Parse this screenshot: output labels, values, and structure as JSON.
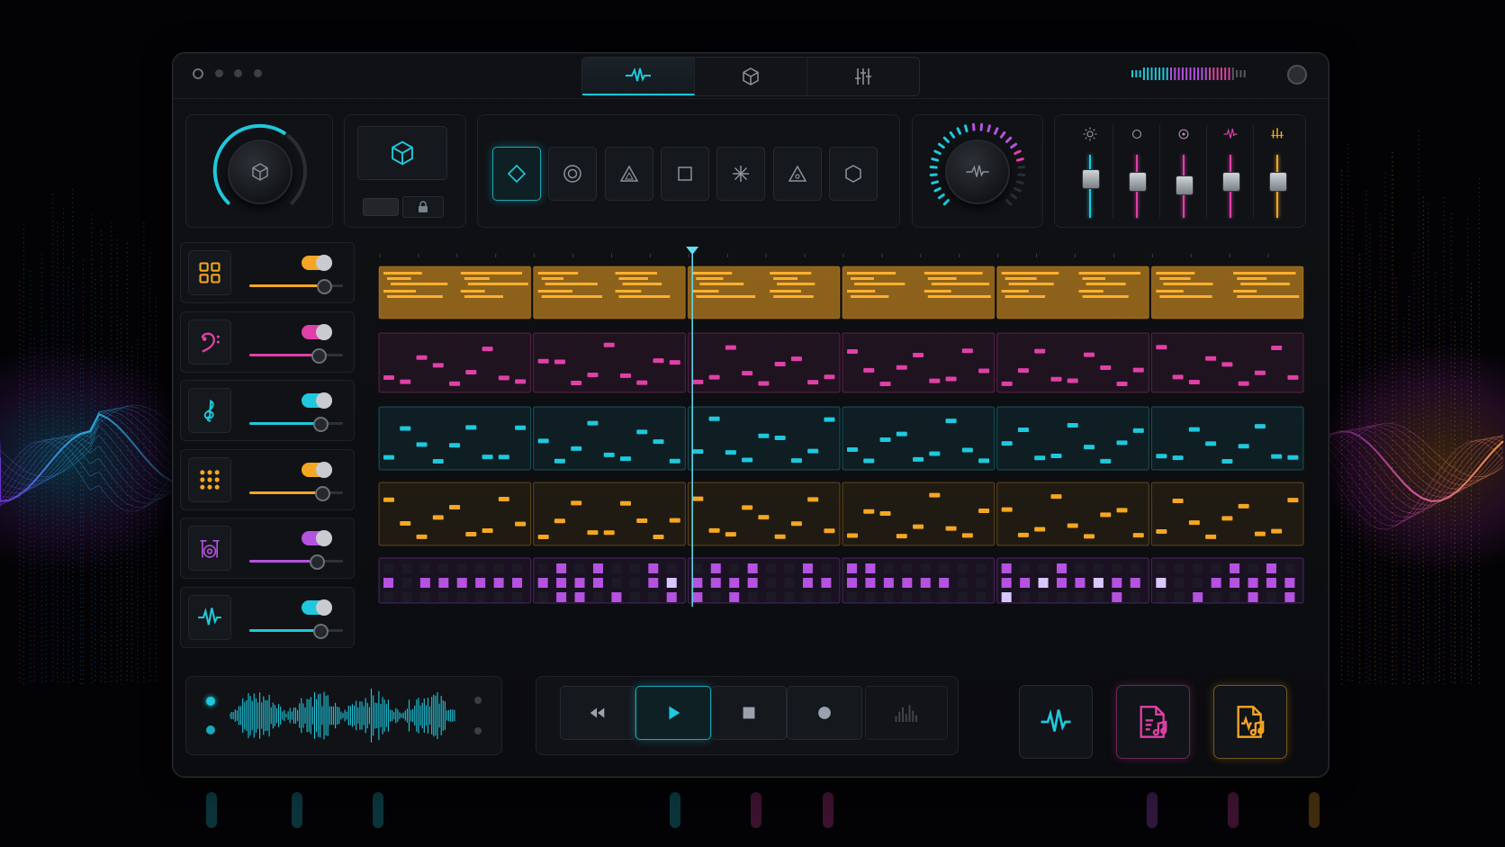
{
  "colors": {
    "cyan": "#1fc8dc",
    "magenta": "#e040a8",
    "orange": "#f5a623",
    "purple": "#b552e0",
    "panel": "#101216"
  },
  "titlebar": {
    "tabs": [
      {
        "icon": "waveform-icon",
        "active": true
      },
      {
        "icon": "cube-icon",
        "active": false
      },
      {
        "icon": "mixer-sliders-icon",
        "active": false
      }
    ]
  },
  "top": {
    "knob_left": {
      "icon": "cube-icon",
      "level": 0.62
    },
    "knob_right": {
      "icon": "waveform-icon",
      "level": 0.78
    },
    "shapes": [
      {
        "icon": "diamond-icon",
        "active": true
      },
      {
        "icon": "target-circle-icon",
        "active": false
      },
      {
        "icon": "triangle-icon",
        "active": false
      },
      {
        "icon": "square-icon",
        "active": false
      },
      {
        "icon": "snowflake-icon",
        "active": false
      },
      {
        "icon": "triangle-dot-icon",
        "active": false
      },
      {
        "icon": "hexagon-icon",
        "active": false
      }
    ],
    "faders": [
      {
        "icon": "sun-icon",
        "color": "#1fc8dc",
        "level": 0.55
      },
      {
        "icon": "circle-icon",
        "color": "#e040a8",
        "level": 0.5
      },
      {
        "icon": "target-icon",
        "color": "#e040a8",
        "level": 0.45
      },
      {
        "icon": "pulse-icon",
        "color": "#e040a8",
        "level": 0.5
      },
      {
        "icon": "bars-icon",
        "color": "#f5a623",
        "level": 0.5
      }
    ]
  },
  "tracks": [
    {
      "icon": "grid-icon",
      "color": "#f5a623",
      "volume": 0.78
    },
    {
      "icon": "bass-clef-icon",
      "color": "#e040a8",
      "volume": 0.72
    },
    {
      "icon": "treble-clef-icon",
      "color": "#1fc8dc",
      "volume": 0.74
    },
    {
      "icon": "dot-grid-icon",
      "color": "#f5a623",
      "volume": 0.76
    },
    {
      "icon": "drum-icon",
      "color": "#b552e0",
      "volume": 0.7
    },
    {
      "icon": "waveform-icon",
      "color": "#1fc8dc",
      "volume": 0.74
    }
  ],
  "sequencer": {
    "playhead": 0.339,
    "bars": 6
  },
  "transport": {
    "buttons": [
      "rewind-icon",
      "play-icon",
      "stop-icon",
      "record-icon",
      "level-meter-icon"
    ],
    "active": "play-icon"
  },
  "actions": [
    "waveform-icon",
    "music-file-icon",
    "audio-file-icon"
  ]
}
